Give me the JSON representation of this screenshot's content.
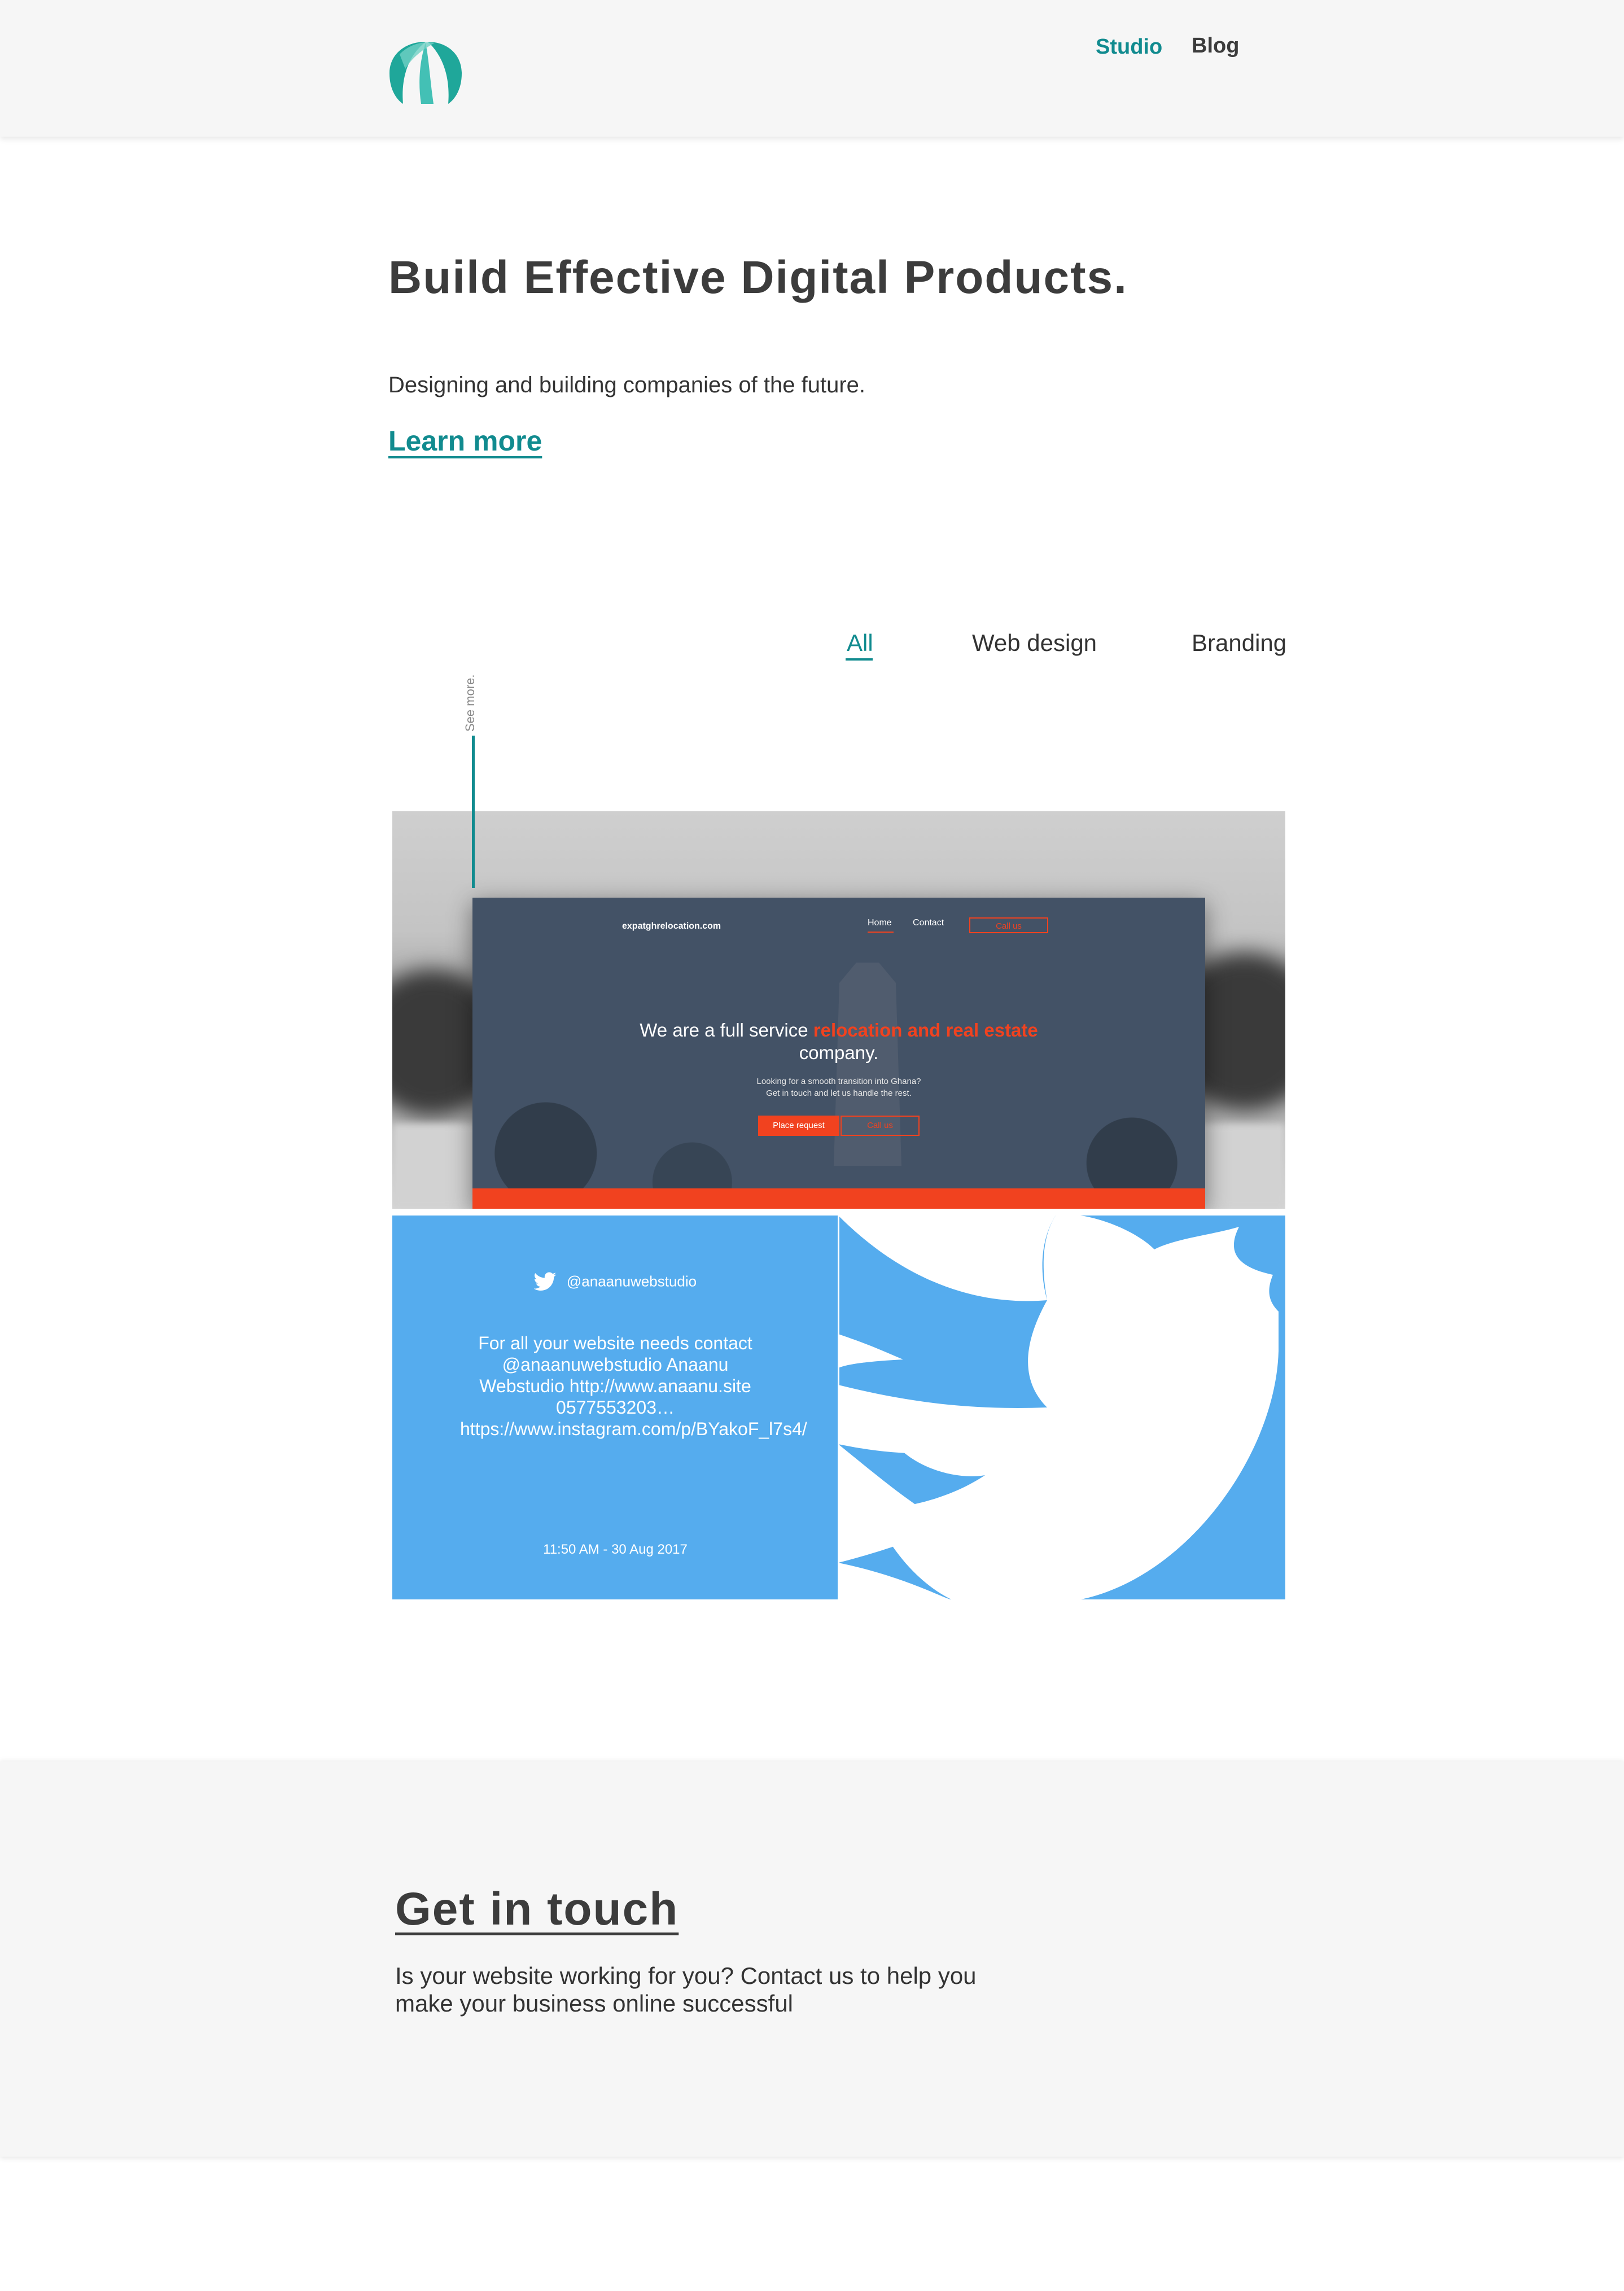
{
  "header": {
    "nav": [
      {
        "label": "Studio",
        "active": true
      },
      {
        "label": "Blog",
        "active": false
      }
    ]
  },
  "hero": {
    "title": "Build Effective Digital Products.",
    "subtitle": "Designing and building companies of the future.",
    "cta": "Learn more"
  },
  "filters": [
    "All",
    "Web design",
    "Branding"
  ],
  "see_more": "See more.",
  "projects": {
    "relocation": {
      "domain": "expatghrelocation.com",
      "nav_home": "Home",
      "nav_contact": "Contact",
      "nav_call": "Call us",
      "headline_pre": "We are a full service ",
      "headline_accent": "relocation and real estate",
      "headline_post": "company.",
      "sub_line1": "Looking for a smooth transition into Ghana?",
      "sub_line2": "Get in touch and let us handle the rest.",
      "btn_place": "Place request",
      "btn_call": "Call us"
    },
    "tweet": {
      "handle": "@anaanuwebstudio",
      "text": "For all your website needs contact @anaanuwebstudio Anaanu Webstudio http://www.anaanu.site 0577553203… https://www.instagram.com/p/BYakoF_l7s4/",
      "time": "11:50 AM - 30 Aug 2017"
    }
  },
  "contact": {
    "title": "Get in touch",
    "text": "Is your website working for you? Contact us to help you make your business online successful"
  },
  "colors": {
    "accent": "#118b8f",
    "twitter_blue": "#55acee",
    "relocation_orange": "#f1421f",
    "mock_navy": "#435266"
  }
}
